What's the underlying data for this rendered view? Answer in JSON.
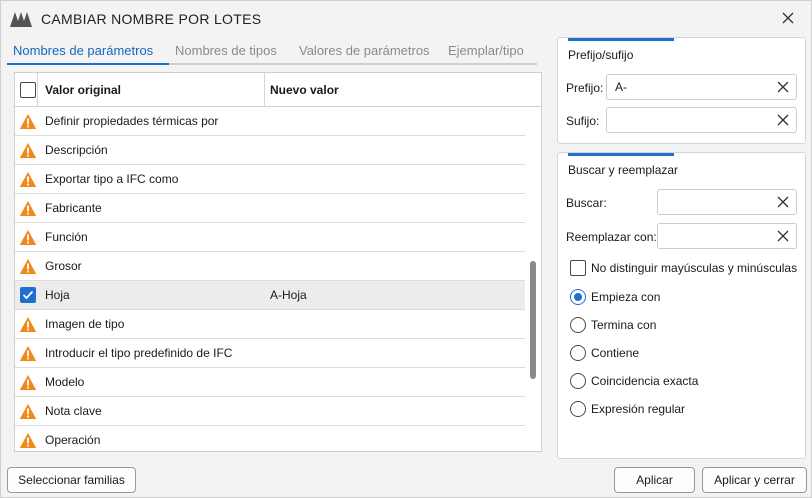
{
  "window": {
    "title": "CAMBIAR NOMBRE POR LOTES"
  },
  "tabs": [
    {
      "label": "Nombres de parámetros",
      "active": true
    },
    {
      "label": "Nombres de tipos",
      "active": false
    },
    {
      "label": "Valores de parámetros",
      "active": false
    },
    {
      "label": "Ejemplar/tipo",
      "active": false
    }
  ],
  "grid": {
    "columns": [
      "Valor original",
      "Nuevo valor"
    ],
    "rows": [
      {
        "original": "Definir propiedades térmicas por",
        "new": "",
        "status": "warning"
      },
      {
        "original": "Descripción",
        "new": "",
        "status": "warning"
      },
      {
        "original": "Exportar tipo a IFC como",
        "new": "",
        "status": "warning"
      },
      {
        "original": "Fabricante",
        "new": "",
        "status": "warning"
      },
      {
        "original": "Función",
        "new": "",
        "status": "warning"
      },
      {
        "original": "Grosor",
        "new": "",
        "status": "warning"
      },
      {
        "original": "Hoja",
        "new": "A-Hoja",
        "status": "checked"
      },
      {
        "original": "Imagen de tipo",
        "new": "",
        "status": "warning"
      },
      {
        "original": "Introducir el tipo predefinido de IFC",
        "new": "",
        "status": "warning"
      },
      {
        "original": "Modelo",
        "new": "",
        "status": "warning"
      },
      {
        "original": "Nota clave",
        "new": "",
        "status": "warning"
      },
      {
        "original": "Operación",
        "new": "",
        "status": "warning"
      }
    ]
  },
  "prefix_panel": {
    "title": "Prefijo/sufijo",
    "prefix_label": "Prefijo:",
    "prefix_value": "A-",
    "suffix_label": "Sufijo:",
    "suffix_value": ""
  },
  "replace_panel": {
    "title": "Buscar y reemplazar",
    "find_label": "Buscar:",
    "find_value": "",
    "replace_label": "Reemplazar con:",
    "replace_value": "",
    "case_label": "No distinguir mayúsculas y minúsculas",
    "case_checked": false,
    "options": [
      {
        "label": "Empieza con",
        "selected": true
      },
      {
        "label": "Termina con",
        "selected": false
      },
      {
        "label": "Contiene",
        "selected": false
      },
      {
        "label": "Coincidencia exacta",
        "selected": false
      },
      {
        "label": "Expresión regular",
        "selected": false
      }
    ]
  },
  "buttons": {
    "select_families": "Seleccionar familias",
    "apply": "Aplicar",
    "apply_close": "Aplicar y cerrar"
  },
  "colors": {
    "accent": "#1f6fd1",
    "warning": "#f2871b"
  }
}
